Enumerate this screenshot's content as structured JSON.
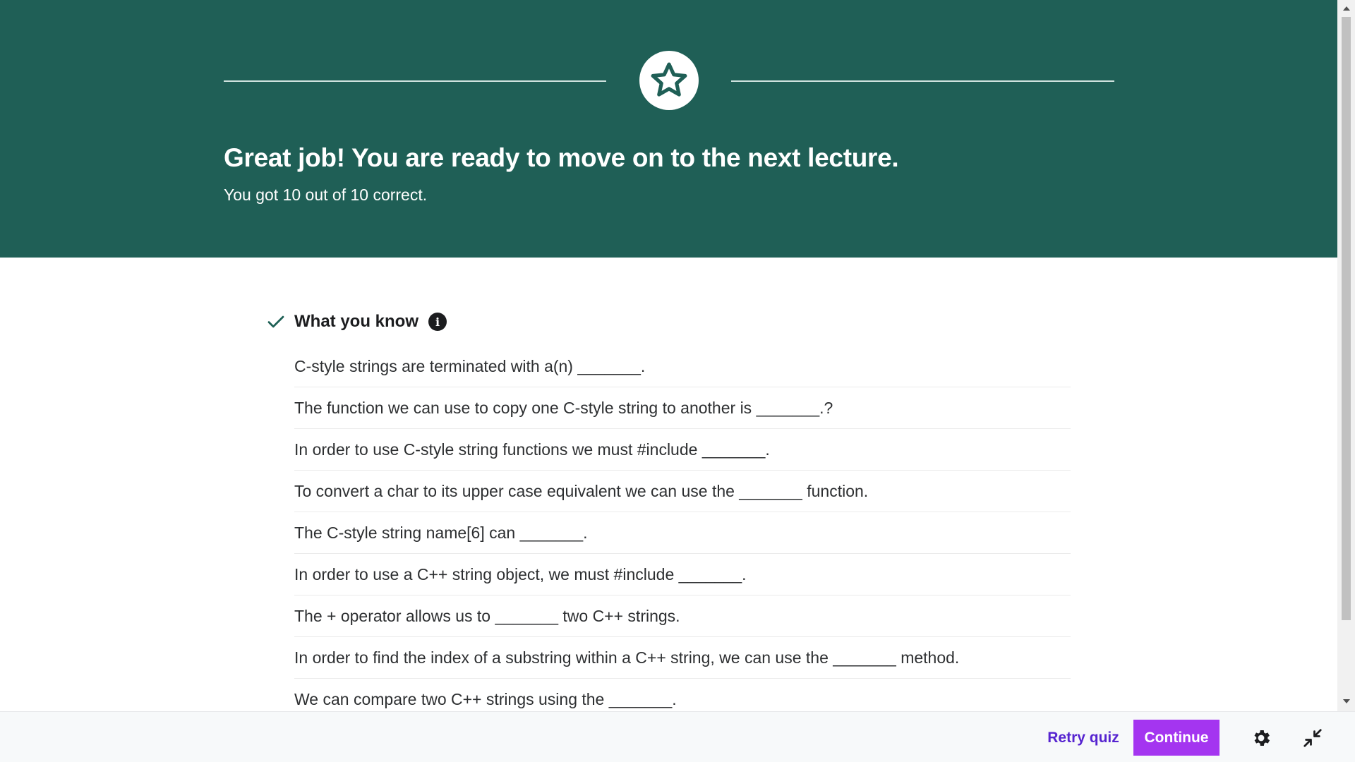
{
  "banner": {
    "title": "Great job! You are ready to move on to the next lecture.",
    "subtitle": "You got 10 out of 10 correct.",
    "background_color": "#1f5f56",
    "icon": "star-icon"
  },
  "knowledge": {
    "header": "What you know",
    "header_icon": "check-icon",
    "info_icon": "info-icon",
    "items": [
      {
        "text": "C-style strings are terminated with a(n) _______."
      },
      {
        "text": "The function we can use to copy one C-style string to another is _______.?"
      },
      {
        "text": "In order to use C-style string functions we must #include _______."
      },
      {
        "text": "To convert a char to its upper case equivalent we can use the _______ function."
      },
      {
        "text": "The C-style string name[6] can _______."
      },
      {
        "text": "In order to use a C++ string object, we must #include _______."
      },
      {
        "text": "The + operator allows us to _______ two C++ strings."
      },
      {
        "text": "In order to find the index of a substring within a C++ string, we can use the _______ method."
      },
      {
        "text": "We can compare two C++ strings using the _______."
      }
    ]
  },
  "footer": {
    "retry_label": "Retry quiz",
    "continue_label": "Continue",
    "settings_icon": "gear-icon",
    "collapse_icon": "collapse-icon",
    "accent_color": "#a435f0",
    "link_color": "#5624d0"
  }
}
